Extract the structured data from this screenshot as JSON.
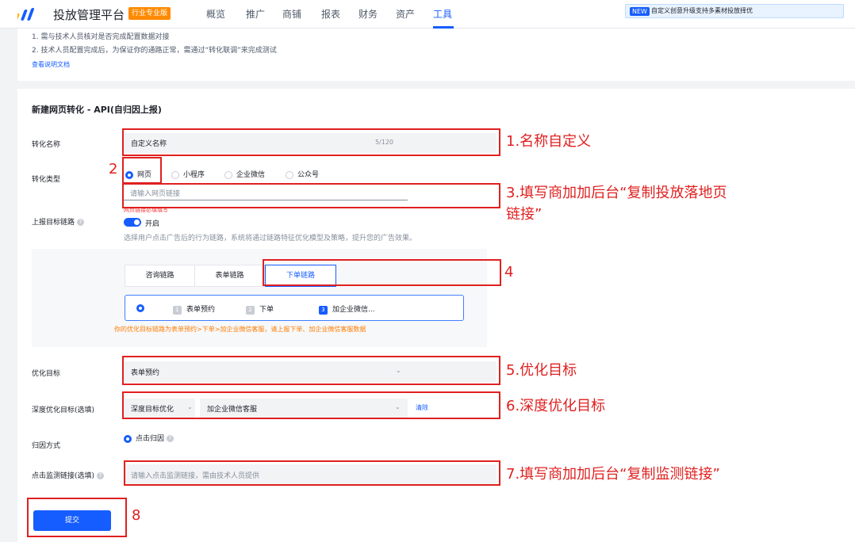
{
  "nav": {
    "brand": "投放管理平台",
    "badge": "行业专业版",
    "items": [
      "概览",
      "推广",
      "商铺",
      "报表",
      "财务",
      "资产",
      "工具"
    ],
    "active_item": "工具",
    "notice_badge": "NEW",
    "notice_text": "自定义创意升级支持多素材投放择优"
  },
  "tips": {
    "line1": "1. 需与技术人员核对是否完成配置数据对接",
    "line2": "2. 技术人员配置完成后，为保证你的通路正常，需通过“转化联调”来完成测试",
    "doc_link": "查看说明文档"
  },
  "form": {
    "title": "新建网页转化 - API(自归因上报)",
    "name_label": "转化名称",
    "name_value": "自定义名称",
    "name_counter": "5/120",
    "type_label": "转化类型",
    "type_options": [
      "网页",
      "小程序",
      "企业微信",
      "公众号"
    ],
    "type_selected": "网页",
    "link_placeholder": "请输入网页链接",
    "link_error": "网页链接必填填写",
    "chain_label": "上报目标链路",
    "chain_toggle_label": "开启",
    "chain_desc": "选择用户点击广告后的行为链路，系统将通过链路特征优化模型及策略，提升您的广告效果。",
    "chain_tabs": [
      "咨询链路",
      "表单链路",
      "下单链路"
    ],
    "chain_active_tab": "下单链路",
    "steps": [
      {
        "num": "1",
        "label": "表单预约"
      },
      {
        "num": "2",
        "label": "下单"
      },
      {
        "num": "3",
        "label": "加企业微信..."
      }
    ],
    "chain_tip": "你的优化目标链路为表单预约>下单>加企业微信客服，请上报下单、加企业微信客服数据",
    "goal_label": "优化目标",
    "goal_value": "表单预约",
    "deep_label": "深度优化目标(选填)",
    "deep_type": "深度目标优化",
    "deep_value": "加企业微信客服",
    "deep_clear": "清除",
    "attr_label": "归因方式",
    "attr_value": "点击归因",
    "monitor_label": "点击监测链接(选填)",
    "monitor_placeholder": "请输入点击监测链接，需由技术人员提供",
    "submit_label": "提交"
  },
  "annotations": {
    "a1": "1.名称自定义",
    "a2": "2",
    "a3_line1": "3.填写商加加后台“复制投放落地页",
    "a3_line2": "链接”",
    "a4": "4",
    "a5": "5.优化目标",
    "a6": "6.深度优化目标",
    "a7": "7.填写商加加后台“复制监测链接”",
    "a8": "8"
  },
  "colors": {
    "primary": "#165dff",
    "annotation_red": "#e02020",
    "badge_orange": "#ff8a00"
  }
}
